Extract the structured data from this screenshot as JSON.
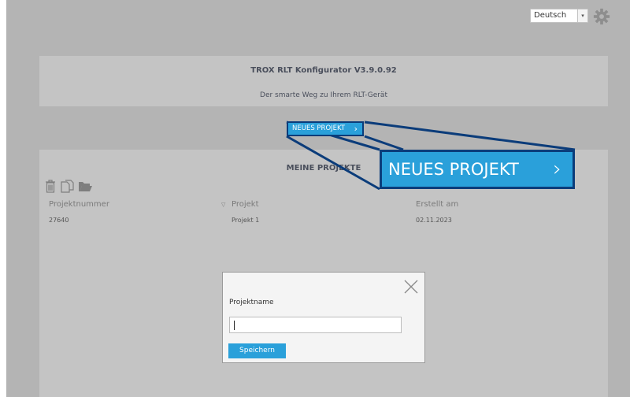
{
  "language_select": {
    "value": "Deutsch",
    "arrow": "▾"
  },
  "settings": {
    "icon": "gear-icon"
  },
  "header": {
    "title": "TROX RLT Konfigurator V3.9.0.92",
    "subtitle": "Der smarte Weg zu Ihrem RLT-Gerät"
  },
  "new_project_button": {
    "label": "NEUES PROJEKT",
    "chevron": "›"
  },
  "projects": {
    "title": "MEINE PROJEKTE",
    "toolbar_icons": [
      "trash-icon",
      "copy-icon",
      "folder-open-icon"
    ],
    "columns": [
      "Projektnummer",
      "Projekt",
      "Erstellt am"
    ],
    "rows": [
      {
        "number": "27640",
        "name": "Projekt 1",
        "created": "02.11.2023"
      }
    ]
  },
  "zoom_callout": {
    "label": "NEUES PROJEKT",
    "chevron": "›"
  },
  "dialog": {
    "field_label": "Projektname",
    "input_value": "",
    "save_label": "Speichern"
  },
  "colors": {
    "background": "#b4b4b4",
    "card": "#c4c4c4",
    "accent": "#2aa0da",
    "callout_border": "#0b3c7a",
    "title_text": "#4a4f5c"
  }
}
